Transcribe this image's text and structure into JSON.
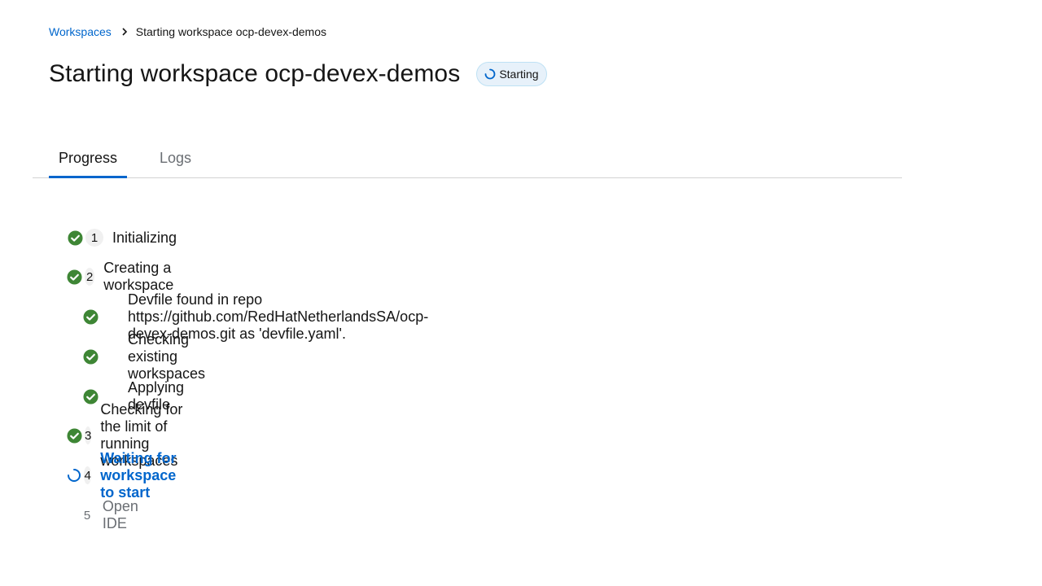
{
  "breadcrumb": {
    "root": "Workspaces",
    "current": "Starting workspace ocp-devex-demos"
  },
  "header": {
    "title": "Starting workspace ocp-devex-demos",
    "status_badge": "Starting",
    "status_icon": "spinner-icon"
  },
  "tabs": [
    {
      "label": "Progress",
      "active": true
    },
    {
      "label": "Logs",
      "active": false
    }
  ],
  "progress": {
    "steps": [
      {
        "number": "1",
        "label": "Initializing",
        "state": "done"
      },
      {
        "number": "2",
        "label": "Creating a workspace",
        "state": "done"
      },
      {
        "number": "3",
        "label": "Checking for the limit of running workspaces",
        "state": "done"
      },
      {
        "number": "4",
        "label": "Waiting for workspace to start",
        "state": "in-progress"
      },
      {
        "number": "5",
        "label": "Open IDE",
        "state": "pending"
      }
    ],
    "substeps": [
      {
        "label": "Devfile found in repo https://github.com/RedHatNetherlandsSA/ocp-devex-demos.git as 'devfile.yaml'.",
        "state": "done"
      },
      {
        "label": "Checking existing workspaces",
        "state": "done"
      },
      {
        "label": "Applying devfile",
        "state": "done"
      }
    ]
  },
  "colors": {
    "accent": "#0066cc",
    "success": "#3e8635",
    "badge_bg": "#e7f1fa"
  }
}
